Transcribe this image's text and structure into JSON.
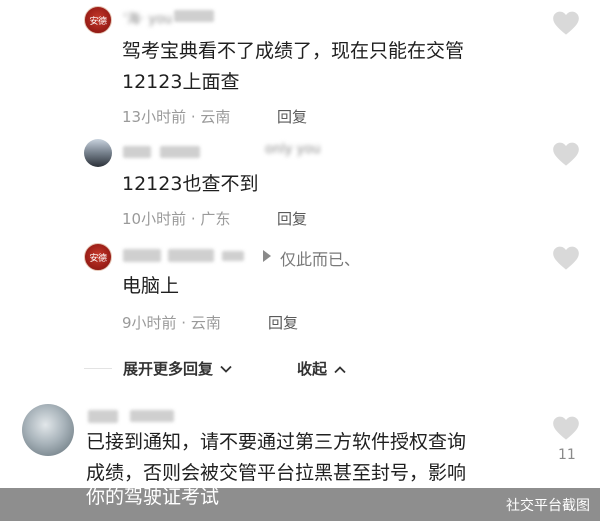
{
  "replies": [
    {
      "name_blurred": "‘海·  you",
      "avatar_label": "安德",
      "lines": [
        "驾考宝典看不了成绩了，现在只能在交管",
        "12123上面查"
      ],
      "meta": "13小时前 · 云南",
      "reply_label": "回复"
    },
    {
      "name_blurred": "only  you",
      "lines": [
        "12123也查不到"
      ],
      "meta": "10小时前 · 广东",
      "reply_label": "回复"
    },
    {
      "avatar_label": "安德",
      "reply_to": "仅此而已、",
      "lines": [
        "电脑上"
      ],
      "meta": "9小时前 · 云南",
      "reply_label": "回复"
    }
  ],
  "expand_label": "展开更多回复",
  "collapse_label": "收起",
  "main_comment": {
    "lines": [
      "已接到通知，请不要通过第三方软件授权查询",
      "成绩，否则会被交管平台拉黑甚至封号，影响",
      "你的驾驶证考试"
    ],
    "like_count": "11"
  },
  "footer_label": "社交平台截图",
  "icons": {
    "like": "heart-icon",
    "expand": "chevron-down-icon",
    "collapse": "chevron-up-icon"
  },
  "colors": {
    "meta": "#9a9a9a",
    "heart": "#d9d9d9",
    "footer_bg": "#6e6e6e"
  }
}
